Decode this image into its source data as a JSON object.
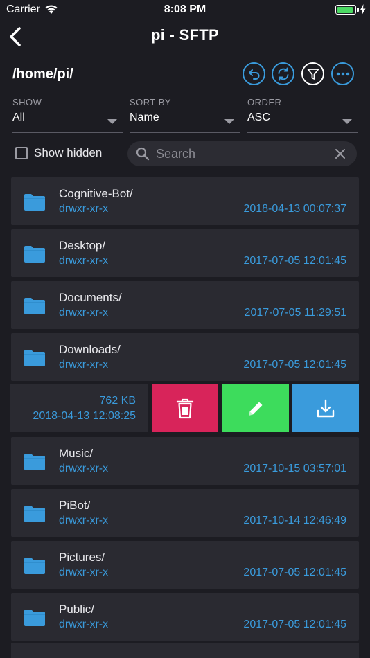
{
  "status_bar": {
    "carrier": "Carrier",
    "time": "8:08 PM",
    "battery_level": 0.9
  },
  "nav": {
    "title": "pi - SFTP",
    "back_icon": "chevron-left-icon"
  },
  "path": "/home/pi/",
  "toolbar": {
    "buttons": [
      "back-arrow-icon",
      "refresh-icon",
      "filter-icon",
      "more-icon"
    ],
    "accent": "#3a9bdc"
  },
  "filters": {
    "show": {
      "label": "SHOW",
      "value": "All"
    },
    "sort_by": {
      "label": "SORT BY",
      "value": "Name"
    },
    "order": {
      "label": "ORDER",
      "value": "ASC"
    }
  },
  "show_hidden": {
    "label": "Show hidden",
    "checked": false
  },
  "search": {
    "placeholder": "Search",
    "value": ""
  },
  "files": [
    {
      "name": "Cognitive-Bot/",
      "perm": "drwxr-xr-x",
      "date": "2018-04-13 00:07:37"
    },
    {
      "name": "Desktop/",
      "perm": "drwxr-xr-x",
      "date": "2017-07-05 12:01:45"
    },
    {
      "name": "Documents/",
      "perm": "drwxr-xr-x",
      "date": "2017-07-05 11:29:51"
    },
    {
      "name": "Downloads/",
      "perm": "drwxr-xr-x",
      "date": "2017-07-05 12:01:45"
    },
    {
      "name": "Music/",
      "perm": "drwxr-xr-x",
      "date": "2017-10-15 03:57:01"
    },
    {
      "name": "PiBot/",
      "perm": "drwxr-xr-x",
      "date": "2017-10-14 12:46:49"
    },
    {
      "name": "Pictures/",
      "perm": "drwxr-xr-x",
      "date": "2017-07-05 12:01:45"
    },
    {
      "name": "Public/",
      "perm": "drwxr-xr-x",
      "date": "2017-07-05 12:01:45"
    }
  ],
  "swiped_row": {
    "size": "762 KB",
    "date": "2018-04-13 12:08:25",
    "actions": [
      {
        "name": "delete",
        "icon": "trash-icon",
        "color": "#d8245a"
      },
      {
        "name": "edit",
        "icon": "pencil-icon",
        "color": "#3ddc5c"
      },
      {
        "name": "download",
        "icon": "download-icon",
        "color": "#3a9bdc"
      }
    ]
  }
}
